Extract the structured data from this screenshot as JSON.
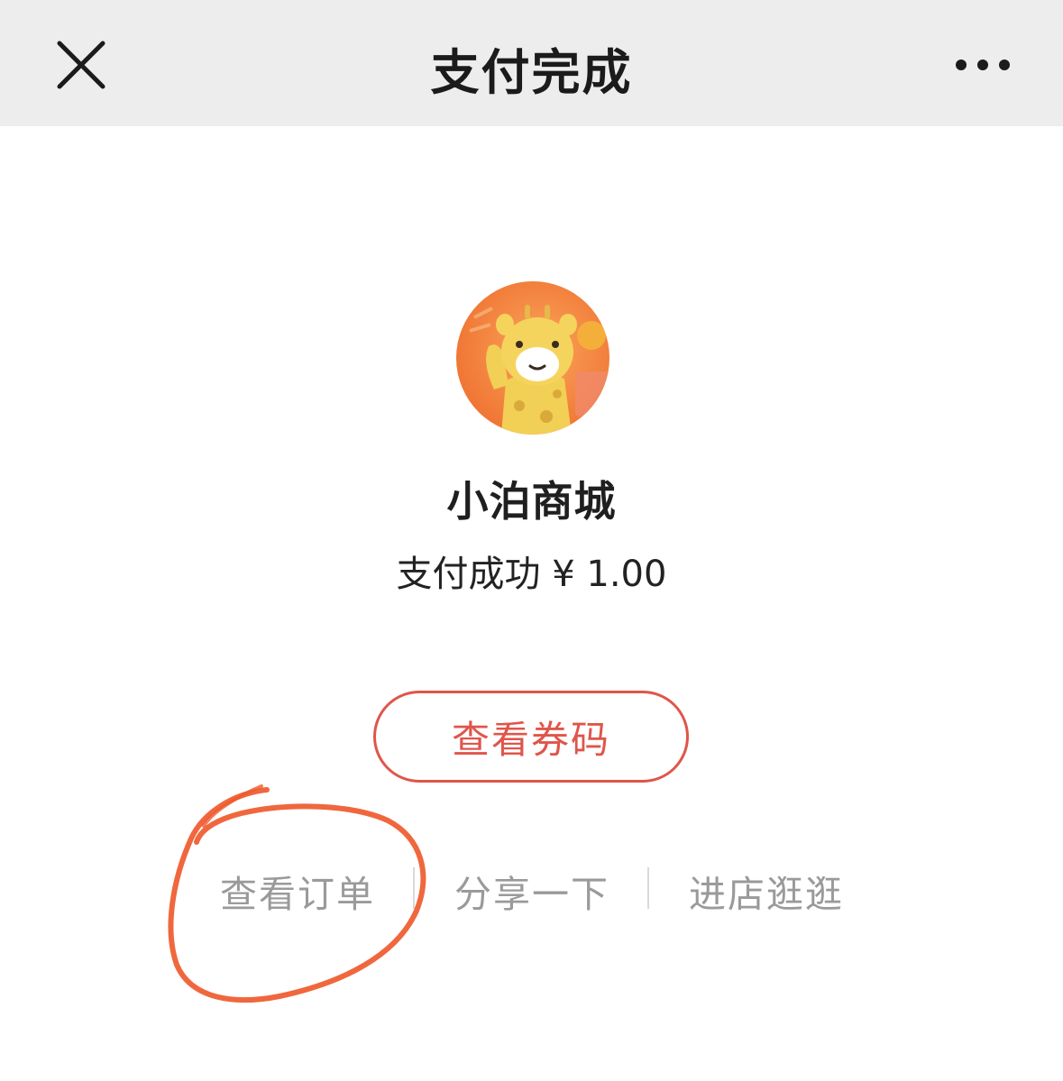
{
  "navbar": {
    "title": "支付完成",
    "close_icon": "close-icon",
    "more_icon": "more-dots-icon",
    "background": "#ededed"
  },
  "merchant": {
    "name": "小泊商城",
    "avatar": "giraffe-mascot-avatar",
    "status": "支付成功 ¥ 1.00"
  },
  "actions": {
    "primary_label": "查看券码",
    "accent_color": "#e0554a",
    "links": [
      "查看订单",
      "分享一下",
      "进店逛逛"
    ]
  },
  "annotation": {
    "shape": "hand-drawn-circle",
    "color": "#ef5a2e"
  }
}
